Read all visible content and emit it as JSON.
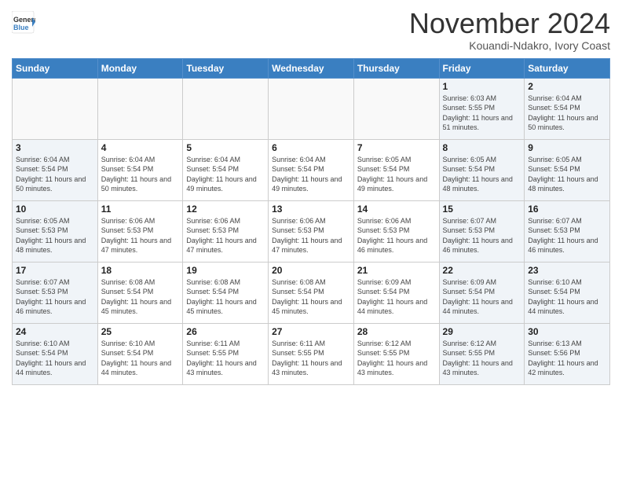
{
  "header": {
    "logo": {
      "general": "General",
      "blue": "Blue",
      "arrow_color": "#3a7fc1"
    },
    "title": "November 2024",
    "location": "Kouandi-Ndakro, Ivory Coast"
  },
  "weekdays": [
    "Sunday",
    "Monday",
    "Tuesday",
    "Wednesday",
    "Thursday",
    "Friday",
    "Saturday"
  ],
  "weeks": [
    [
      {
        "day": "",
        "sunrise": "",
        "sunset": "",
        "daylight": "",
        "type": "empty"
      },
      {
        "day": "",
        "sunrise": "",
        "sunset": "",
        "daylight": "",
        "type": "empty"
      },
      {
        "day": "",
        "sunrise": "",
        "sunset": "",
        "daylight": "",
        "type": "empty"
      },
      {
        "day": "",
        "sunrise": "",
        "sunset": "",
        "daylight": "",
        "type": "empty"
      },
      {
        "day": "",
        "sunrise": "",
        "sunset": "",
        "daylight": "",
        "type": "empty"
      },
      {
        "day": "1",
        "sunrise": "Sunrise: 6:03 AM",
        "sunset": "Sunset: 5:55 PM",
        "daylight": "Daylight: 11 hours and 51 minutes.",
        "type": "weekend"
      },
      {
        "day": "2",
        "sunrise": "Sunrise: 6:04 AM",
        "sunset": "Sunset: 5:54 PM",
        "daylight": "Daylight: 11 hours and 50 minutes.",
        "type": "weekend"
      }
    ],
    [
      {
        "day": "3",
        "sunrise": "Sunrise: 6:04 AM",
        "sunset": "Sunset: 5:54 PM",
        "daylight": "Daylight: 11 hours and 50 minutes.",
        "type": "weekend"
      },
      {
        "day": "4",
        "sunrise": "Sunrise: 6:04 AM",
        "sunset": "Sunset: 5:54 PM",
        "daylight": "Daylight: 11 hours and 50 minutes.",
        "type": "weekday"
      },
      {
        "day": "5",
        "sunrise": "Sunrise: 6:04 AM",
        "sunset": "Sunset: 5:54 PM",
        "daylight": "Daylight: 11 hours and 49 minutes.",
        "type": "weekday"
      },
      {
        "day": "6",
        "sunrise": "Sunrise: 6:04 AM",
        "sunset": "Sunset: 5:54 PM",
        "daylight": "Daylight: 11 hours and 49 minutes.",
        "type": "weekday"
      },
      {
        "day": "7",
        "sunrise": "Sunrise: 6:05 AM",
        "sunset": "Sunset: 5:54 PM",
        "daylight": "Daylight: 11 hours and 49 minutes.",
        "type": "weekday"
      },
      {
        "day": "8",
        "sunrise": "Sunrise: 6:05 AM",
        "sunset": "Sunset: 5:54 PM",
        "daylight": "Daylight: 11 hours and 48 minutes.",
        "type": "weekend"
      },
      {
        "day": "9",
        "sunrise": "Sunrise: 6:05 AM",
        "sunset": "Sunset: 5:54 PM",
        "daylight": "Daylight: 11 hours and 48 minutes.",
        "type": "weekend"
      }
    ],
    [
      {
        "day": "10",
        "sunrise": "Sunrise: 6:05 AM",
        "sunset": "Sunset: 5:53 PM",
        "daylight": "Daylight: 11 hours and 48 minutes.",
        "type": "weekend"
      },
      {
        "day": "11",
        "sunrise": "Sunrise: 6:06 AM",
        "sunset": "Sunset: 5:53 PM",
        "daylight": "Daylight: 11 hours and 47 minutes.",
        "type": "weekday"
      },
      {
        "day": "12",
        "sunrise": "Sunrise: 6:06 AM",
        "sunset": "Sunset: 5:53 PM",
        "daylight": "Daylight: 11 hours and 47 minutes.",
        "type": "weekday"
      },
      {
        "day": "13",
        "sunrise": "Sunrise: 6:06 AM",
        "sunset": "Sunset: 5:53 PM",
        "daylight": "Daylight: 11 hours and 47 minutes.",
        "type": "weekday"
      },
      {
        "day": "14",
        "sunrise": "Sunrise: 6:06 AM",
        "sunset": "Sunset: 5:53 PM",
        "daylight": "Daylight: 11 hours and 46 minutes.",
        "type": "weekday"
      },
      {
        "day": "15",
        "sunrise": "Sunrise: 6:07 AM",
        "sunset": "Sunset: 5:53 PM",
        "daylight": "Daylight: 11 hours and 46 minutes.",
        "type": "weekend"
      },
      {
        "day": "16",
        "sunrise": "Sunrise: 6:07 AM",
        "sunset": "Sunset: 5:53 PM",
        "daylight": "Daylight: 11 hours and 46 minutes.",
        "type": "weekend"
      }
    ],
    [
      {
        "day": "17",
        "sunrise": "Sunrise: 6:07 AM",
        "sunset": "Sunset: 5:53 PM",
        "daylight": "Daylight: 11 hours and 46 minutes.",
        "type": "weekend"
      },
      {
        "day": "18",
        "sunrise": "Sunrise: 6:08 AM",
        "sunset": "Sunset: 5:54 PM",
        "daylight": "Daylight: 11 hours and 45 minutes.",
        "type": "weekday"
      },
      {
        "day": "19",
        "sunrise": "Sunrise: 6:08 AM",
        "sunset": "Sunset: 5:54 PM",
        "daylight": "Daylight: 11 hours and 45 minutes.",
        "type": "weekday"
      },
      {
        "day": "20",
        "sunrise": "Sunrise: 6:08 AM",
        "sunset": "Sunset: 5:54 PM",
        "daylight": "Daylight: 11 hours and 45 minutes.",
        "type": "weekday"
      },
      {
        "day": "21",
        "sunrise": "Sunrise: 6:09 AM",
        "sunset": "Sunset: 5:54 PM",
        "daylight": "Daylight: 11 hours and 44 minutes.",
        "type": "weekday"
      },
      {
        "day": "22",
        "sunrise": "Sunrise: 6:09 AM",
        "sunset": "Sunset: 5:54 PM",
        "daylight": "Daylight: 11 hours and 44 minutes.",
        "type": "weekend"
      },
      {
        "day": "23",
        "sunrise": "Sunrise: 6:10 AM",
        "sunset": "Sunset: 5:54 PM",
        "daylight": "Daylight: 11 hours and 44 minutes.",
        "type": "weekend"
      }
    ],
    [
      {
        "day": "24",
        "sunrise": "Sunrise: 6:10 AM",
        "sunset": "Sunset: 5:54 PM",
        "daylight": "Daylight: 11 hours and 44 minutes.",
        "type": "weekend"
      },
      {
        "day": "25",
        "sunrise": "Sunrise: 6:10 AM",
        "sunset": "Sunset: 5:54 PM",
        "daylight": "Daylight: 11 hours and 44 minutes.",
        "type": "weekday"
      },
      {
        "day": "26",
        "sunrise": "Sunrise: 6:11 AM",
        "sunset": "Sunset: 5:55 PM",
        "daylight": "Daylight: 11 hours and 43 minutes.",
        "type": "weekday"
      },
      {
        "day": "27",
        "sunrise": "Sunrise: 6:11 AM",
        "sunset": "Sunset: 5:55 PM",
        "daylight": "Daylight: 11 hours and 43 minutes.",
        "type": "weekday"
      },
      {
        "day": "28",
        "sunrise": "Sunrise: 6:12 AM",
        "sunset": "Sunset: 5:55 PM",
        "daylight": "Daylight: 11 hours and 43 minutes.",
        "type": "weekday"
      },
      {
        "day": "29",
        "sunrise": "Sunrise: 6:12 AM",
        "sunset": "Sunset: 5:55 PM",
        "daylight": "Daylight: 11 hours and 43 minutes.",
        "type": "weekend"
      },
      {
        "day": "30",
        "sunrise": "Sunrise: 6:13 AM",
        "sunset": "Sunset: 5:56 PM",
        "daylight": "Daylight: 11 hours and 42 minutes.",
        "type": "weekend"
      }
    ]
  ]
}
